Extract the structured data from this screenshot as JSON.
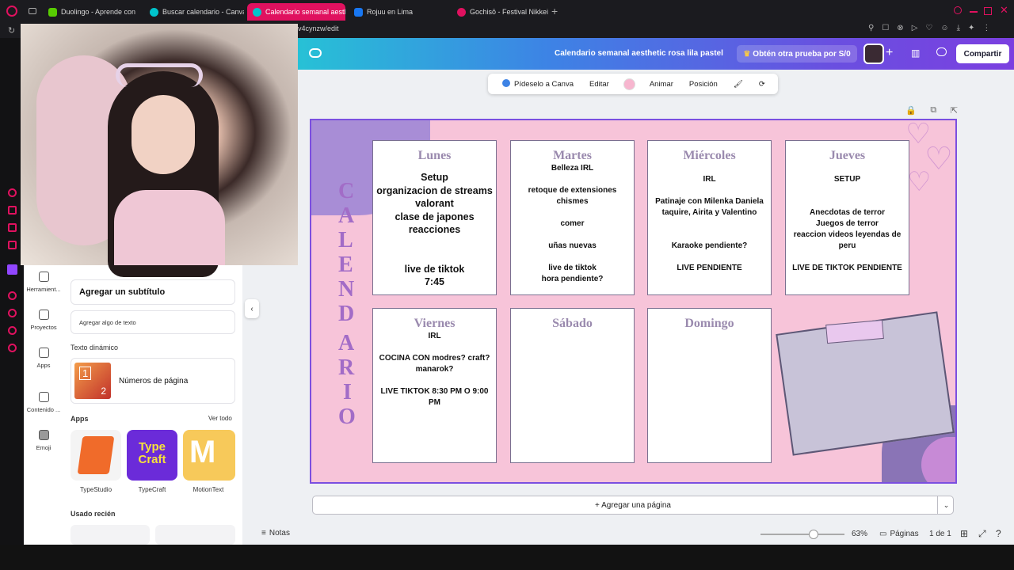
{
  "browser": {
    "tabs": [
      {
        "label": "Duolingo - Aprende con le",
        "color": "#58cc02"
      },
      {
        "label": "Buscar calendario - Canva",
        "color": "#00c4cc"
      },
      {
        "label": "Calendario semanal aesth",
        "color": "#00c4cc",
        "active": true
      },
      {
        "label": "Rojuu en Lima",
        "color": "#1877f2"
      },
      {
        "label": "Gochisō - Festival Nikkei",
        "color": "#e0115f"
      }
    ],
    "url": "v4cynzw/edit"
  },
  "canva": {
    "doc_title": "Calendario semanal aesthetic rosa lila pastel",
    "trial_label": "Obtén otra prueba por S/0",
    "share_label": "Compartir",
    "floatbar": {
      "ai": "Pídeselo a Canva",
      "edit": "Editar",
      "animate": "Animar",
      "position": "Posición"
    },
    "rail": [
      {
        "label": "Herramient...",
        "icon": "tools-icon"
      },
      {
        "label": "Proyectos",
        "icon": "folder-icon"
      },
      {
        "label": "Apps",
        "icon": "apps-icon"
      },
      {
        "label": "Contenido ...",
        "icon": "content-icon"
      },
      {
        "label": "Emoji",
        "icon": "emoji-icon"
      }
    ],
    "panel": {
      "subtitle": "Agregar un subtítulo",
      "body": "Agregar algo de texto",
      "dynamic_title": "Texto dinámico",
      "page_numbers": "Números de página",
      "apps_title": "Apps",
      "see_all": "Ver todo",
      "apps": [
        {
          "name": "TypeStudio",
          "color": "#f2f2f2"
        },
        {
          "name": "TypeCraft",
          "color": "#6b2bd9"
        },
        {
          "name": "MotionText",
          "color": "#f7c95a"
        }
      ],
      "recent_title": "Usado recién"
    },
    "add_page_label": "+ Agregar una página",
    "status": {
      "notes": "Notas",
      "zoom": "63%",
      "pages_label": "Páginas",
      "page_count": "1 de 1",
      "zoom_level": 0.63
    }
  },
  "calendar": {
    "vertical_title": [
      "C",
      "A",
      "L",
      "E",
      "N",
      "D",
      "A",
      "R",
      "I",
      "O"
    ],
    "days": [
      {
        "name": "Lunes",
        "text": "Setup\norganizacion de streams\nvalorant\nclase de japones\nreacciones\n\n\nlive de tiktok\n7:45",
        "big": true
      },
      {
        "name": "Martes",
        "text": "Belleza IRL\n\nretoque de extensiones\nchismes\n\ncomer\n\nuñas nuevas\n\nlive de tiktok\nhora pendiente?",
        "big": false
      },
      {
        "name": "Miércoles",
        "text": "\nIRL\n\nPatinaje con Milenka Daniela taquire, Airita y Valentino\n\n\nKaraoke pendiente?\n\nLIVE PENDIENTE",
        "big": false
      },
      {
        "name": "Jueves",
        "text": "\nSETUP\n\n\nAnecdotas de terror\nJuegos de terror\nreaccion videos leyendas de peru\n\nLIVE DE TIKTOK PENDIENTE",
        "big": false
      },
      {
        "name": "Viernes",
        "text": "IRL\n\nCOCINA CON modres? craft? manarok?\n\nLIVE TIKTOK 8:30 PM O 9:00 PM",
        "big": false
      },
      {
        "name": "Sábado",
        "text": "",
        "big": false
      },
      {
        "name": "Domingo",
        "text": "",
        "big": false
      }
    ]
  }
}
